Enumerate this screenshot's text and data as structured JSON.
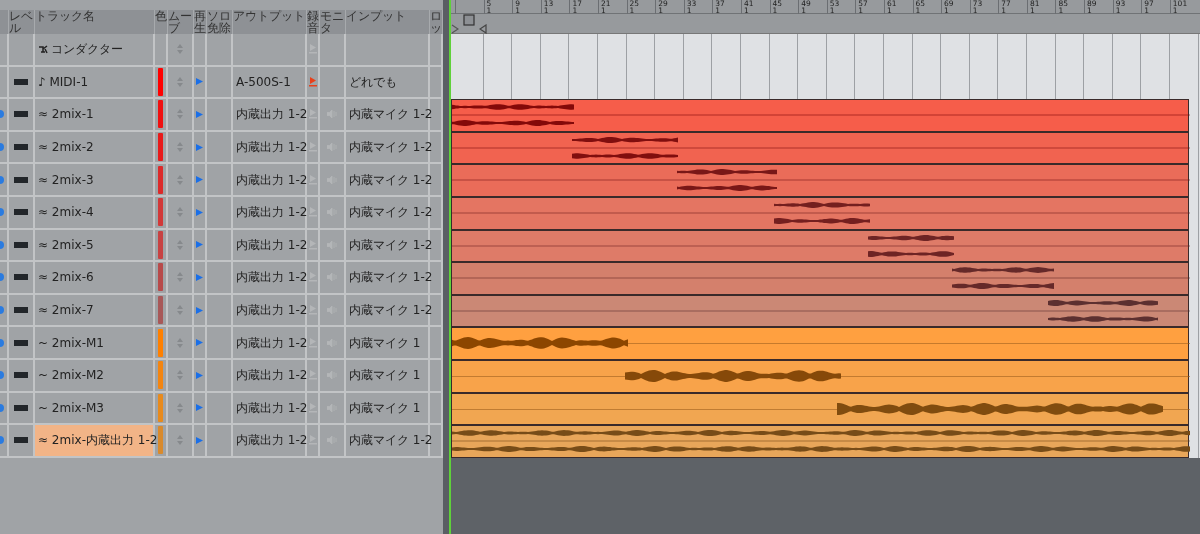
{
  "header_columns": [
    {
      "label": "レベル"
    },
    {
      "label": "トラック名"
    },
    {
      "label": "色"
    },
    {
      "label": "ムーブ"
    },
    {
      "label": "再生"
    },
    {
      "label": "ソロ免除"
    },
    {
      "label": "アウトプット"
    },
    {
      "label": "録音"
    },
    {
      "label": "モニタ"
    },
    {
      "label": "インプット"
    },
    {
      "label": "ロッ"
    }
  ],
  "ruler": [
    {
      "bar": "5",
      "beat": "1"
    },
    {
      "bar": "9",
      "beat": "1"
    },
    {
      "bar": "13",
      "beat": "1"
    },
    {
      "bar": "17",
      "beat": "1"
    },
    {
      "bar": "21",
      "beat": "1"
    },
    {
      "bar": "25",
      "beat": "1"
    },
    {
      "bar": "29",
      "beat": "1"
    },
    {
      "bar": "33",
      "beat": "1"
    },
    {
      "bar": "37",
      "beat": "1"
    },
    {
      "bar": "41",
      "beat": "1"
    },
    {
      "bar": "45",
      "beat": "1"
    },
    {
      "bar": "49",
      "beat": "1"
    },
    {
      "bar": "53",
      "beat": "1"
    },
    {
      "bar": "57",
      "beat": "1"
    },
    {
      "bar": "61",
      "beat": "1"
    },
    {
      "bar": "65",
      "beat": "1"
    },
    {
      "bar": "69",
      "beat": "1"
    },
    {
      "bar": "73",
      "beat": "1"
    },
    {
      "bar": "77",
      "beat": "1"
    },
    {
      "bar": "81",
      "beat": "1"
    },
    {
      "bar": "85",
      "beat": "1"
    },
    {
      "bar": "89",
      "beat": "1"
    },
    {
      "bar": "93",
      "beat": "1"
    },
    {
      "bar": "97",
      "beat": "1"
    },
    {
      "bar": "101",
      "beat": "1"
    }
  ],
  "tracks": [
    {
      "kind": "conductor",
      "name": "コンダクター",
      "selected": false,
      "record_armed": false
    },
    {
      "kind": "midi",
      "glyph": "♪",
      "name": "MIDI-1",
      "color": "#ff0000",
      "output": "A-500S-1",
      "input": "どれでも",
      "selected": false,
      "record_armed": true
    },
    {
      "kind": "audio",
      "glyph": "≈",
      "name": "2mix-1",
      "color": "#f01010",
      "output": "内蔵出力 1-2",
      "input": "内蔵マイク 1-2",
      "selected": false,
      "record_armed": false
    },
    {
      "kind": "audio",
      "glyph": "≈",
      "name": "2mix-2",
      "color": "#e81a1a",
      "output": "内蔵出力 1-2",
      "input": "内蔵マイク 1-2",
      "selected": false,
      "record_armed": false
    },
    {
      "kind": "audio",
      "glyph": "≈",
      "name": "2mix-3",
      "color": "#dc2a2a",
      "output": "内蔵出力 1-2",
      "input": "内蔵マイク 1-2",
      "selected": false,
      "record_armed": false
    },
    {
      "kind": "audio",
      "glyph": "≈",
      "name": "2mix-4",
      "color": "#d23838",
      "output": "内蔵出力 1-2",
      "input": "内蔵マイク 1-2",
      "selected": false,
      "record_armed": false
    },
    {
      "kind": "audio",
      "glyph": "≈",
      "name": "2mix-5",
      "color": "#c84242",
      "output": "内蔵出力 1-2",
      "input": "内蔵マイク 1-2",
      "selected": false,
      "record_armed": false
    },
    {
      "kind": "audio",
      "glyph": "≈",
      "name": "2mix-6",
      "color": "#b84a4a",
      "output": "内蔵出力 1-2",
      "input": "内蔵マイク 1-2",
      "selected": false,
      "record_armed": false
    },
    {
      "kind": "audio",
      "glyph": "≈",
      "name": "2mix-7",
      "color": "#a85858",
      "output": "内蔵出力 1-2",
      "input": "内蔵マイク 1-2",
      "selected": false,
      "record_armed": false
    },
    {
      "kind": "audio",
      "glyph": "~",
      "name": "2mix-M1",
      "color": "#ff8000",
      "output": "内蔵出力 1-2",
      "input": "内蔵マイク 1",
      "selected": false,
      "record_armed": false
    },
    {
      "kind": "audio",
      "glyph": "~",
      "name": "2mix-M2",
      "color": "#f48510",
      "output": "内蔵出力 1-2",
      "input": "内蔵マイク 1",
      "selected": false,
      "record_armed": false
    },
    {
      "kind": "audio",
      "glyph": "~",
      "name": "2mix-M3",
      "color": "#e88a1c",
      "output": "内蔵出力 1-2",
      "input": "内蔵マイク 1",
      "selected": false,
      "record_armed": false
    },
    {
      "kind": "audio",
      "glyph": "≈",
      "name": "2mix-内蔵出力 1-2",
      "color": "#d98a2c",
      "output": "内蔵出力 1-2",
      "input": "内蔵マイク 1-2",
      "selected": true,
      "record_armed": false
    }
  ]
}
